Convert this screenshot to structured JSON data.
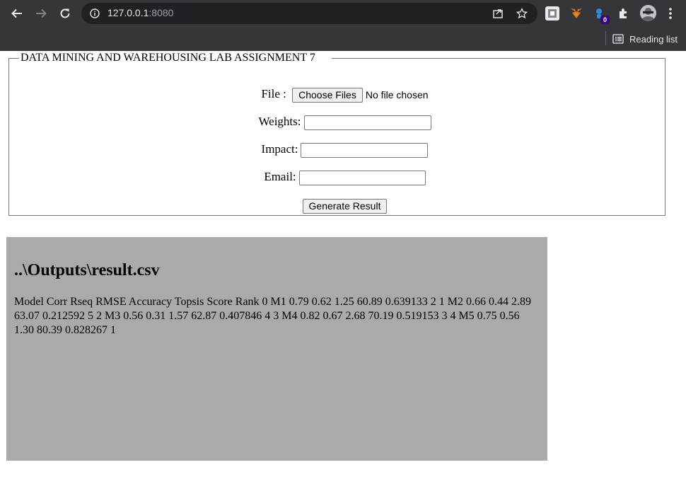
{
  "browser": {
    "url_host": "127.0.0.1",
    "url_port": ":8080",
    "reading_list_label": "Reading list",
    "extension_badge": "0"
  },
  "form": {
    "legend": "DATA MINING AND WAREHOUSING LAB ASSIGNMENT 7",
    "file_label": "File :",
    "choose_files_label": "Choose Files",
    "no_file_text": "No file chosen",
    "weights_label": "Weights:",
    "weights_value": "",
    "impact_label": "Impact:",
    "impact_value": "",
    "email_label": "Email:",
    "email_value": "",
    "submit_label": "Generate Result"
  },
  "result": {
    "title": "..\\Outputs\\result.csv",
    "content": "Model Corr Rseq RMSE Accuracy Topsis Score Rank 0 M1 0.79 0.62 1.25 60.89 0.639133 2 1 M2 0.66 0.44 2.89 63.07 0.212592 5 2 M3 0.56 0.31 1.57 62.87 0.407846 4 3 M4 0.82 0.67 2.68 70.19 0.519153 3 4 M5 0.75 0.56 1.30 80.39 0.828267 1"
  }
}
